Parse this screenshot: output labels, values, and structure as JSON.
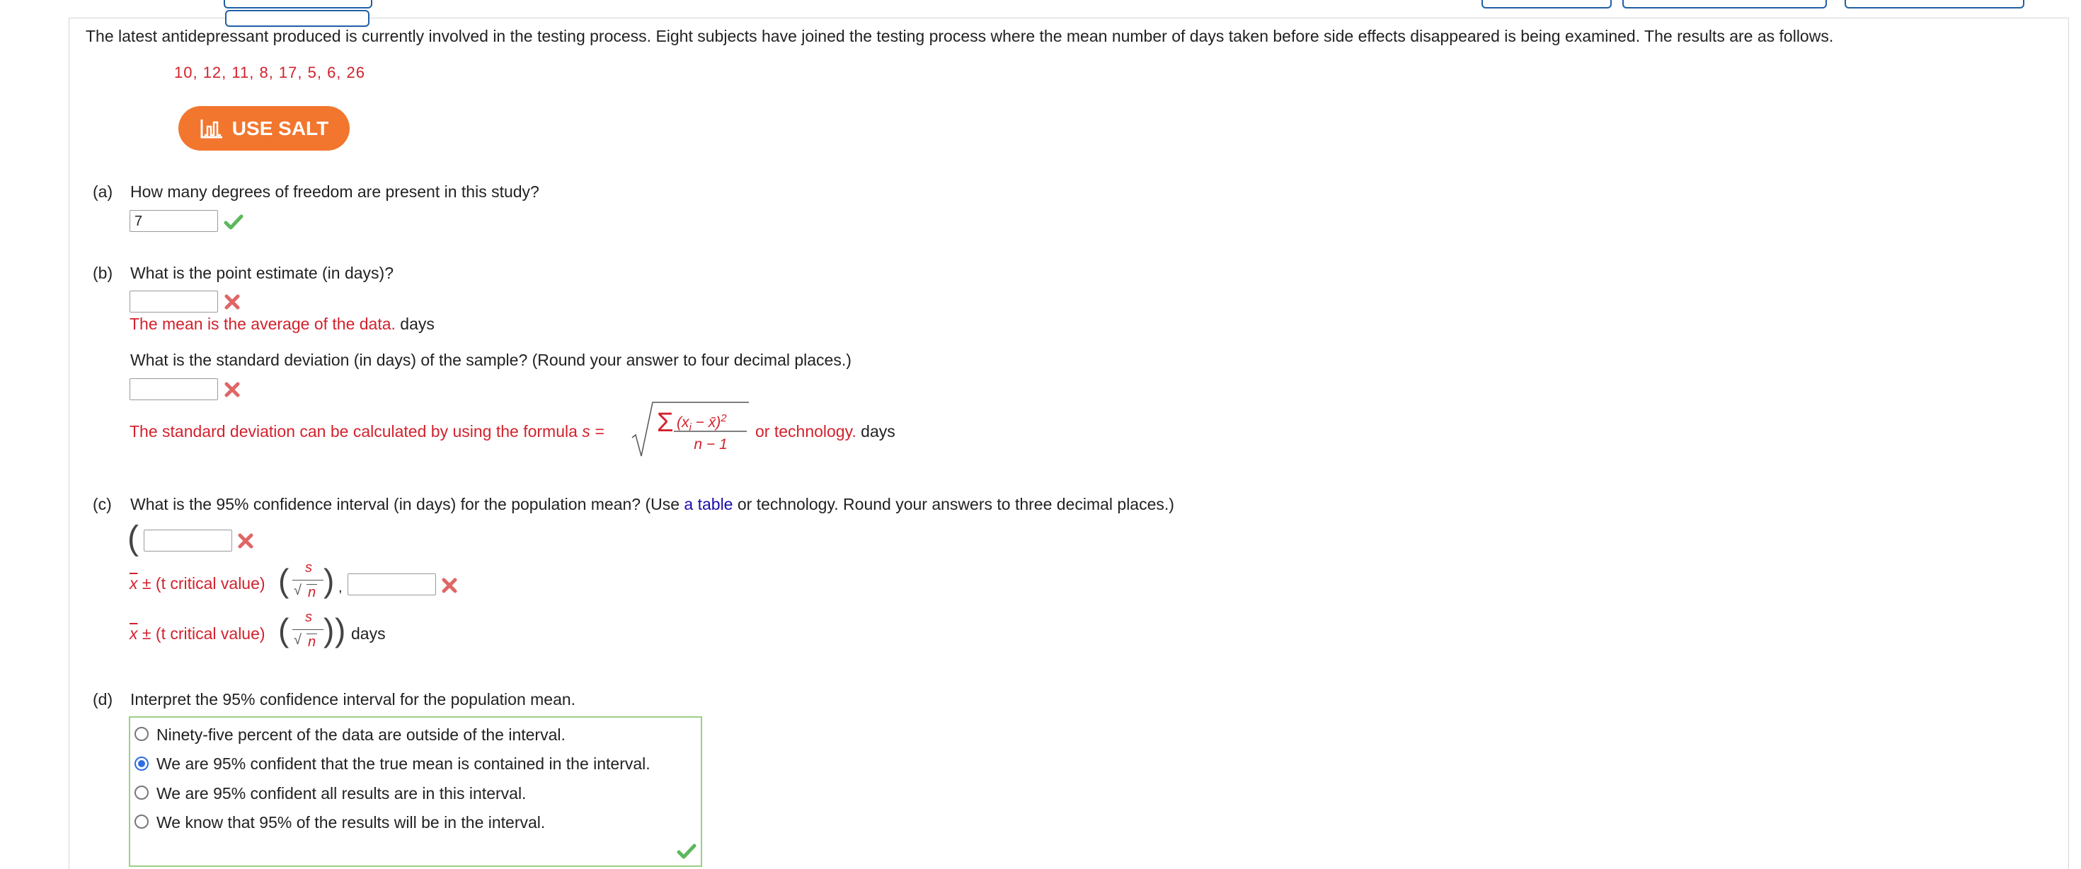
{
  "problem": {
    "text": "The latest antidepressant produced is currently involved in the testing process. Eight subjects have joined the testing process where the mean number of days taken before side effects disappeared is being examined. The results are as follows.",
    "data_values": "10, 12, 11, 8, 17, 5, 6, 26",
    "salt_label": "USE SALT"
  },
  "part_a": {
    "label": "(a)",
    "question": "How many degrees of freedom are present in this study?",
    "answer": "7"
  },
  "part_b": {
    "label": "(b)",
    "question": "What is the point estimate (in days)?",
    "answer": "",
    "hint": "The mean is the average of the data.",
    "unit": "days",
    "sd_question": "What is the standard deviation (in days) of the sample? (Round your answer to four decimal places.)",
    "sd_answer": "",
    "sd_hint": "The standard deviation can be calculated by using the formula",
    "sd_s_eq": "s =",
    "sd_formula_num": "(x",
    "sd_formula_sub": "i",
    "sd_formula_rest": " − x̄)",
    "sd_formula_sup": "2",
    "sd_formula_den": "n − 1",
    "sd_tail": "or technology.",
    "sd_unit": "days"
  },
  "part_c": {
    "label": "(c)",
    "question_pre": "What is the 95% confidence interval (in days) for the population mean? (Use",
    "question_link": "a table",
    "question_post": "or technology. Round your answers to three decimal places.)",
    "lower_answer": "",
    "upper_answer": "",
    "hint_xbar": "x",
    "hint_text": "± (t critical value)",
    "frac_num": "s",
    "frac_den": "n",
    "unit": "days"
  },
  "part_d": {
    "label": "(d)",
    "question": "Interpret the 95% confidence interval for the population mean.",
    "options": [
      "Ninety-five percent of the data are outside of the interval.",
      "We are 95% confident that the true mean is contained in the interval.",
      "We are 95% confident all results are in this interval.",
      "We know that 95% of the results will be in the interval."
    ],
    "selected_index": 1
  },
  "colors": {
    "hint_red": "#d2222d",
    "salt_orange": "#f2762e",
    "correct_green": "#5cb85c",
    "link_blue": "#1a0dab",
    "radio_blue": "#2d6fe0"
  }
}
